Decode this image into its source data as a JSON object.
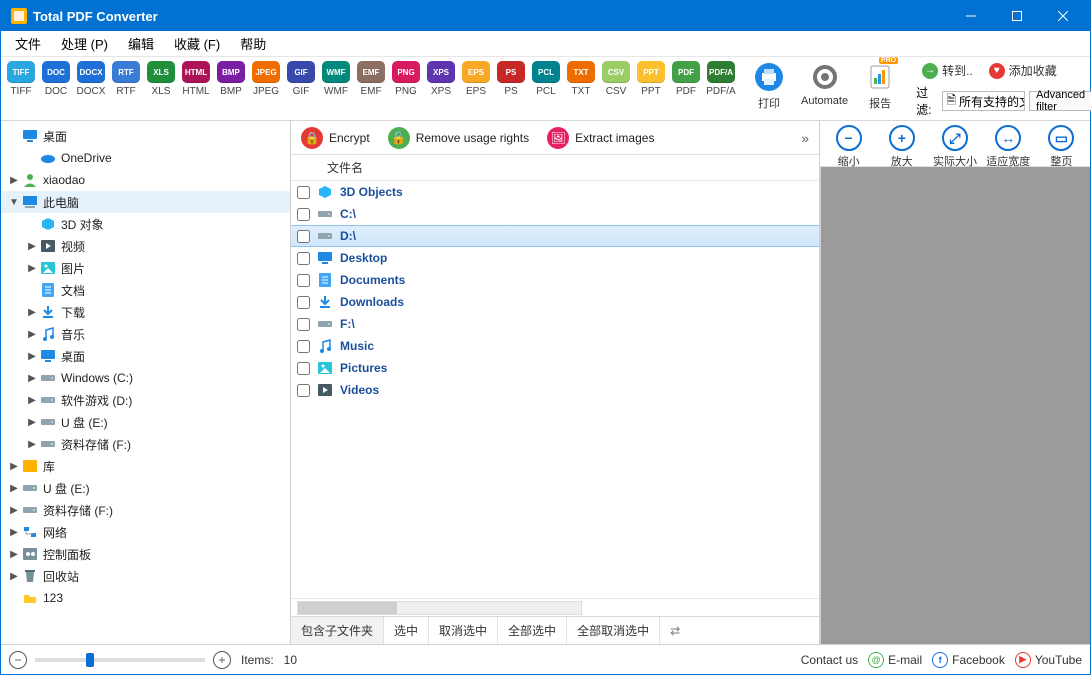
{
  "title": "Total PDF Converter",
  "menu": [
    "文件",
    "处理 (P)",
    "编辑",
    "收藏 (F)",
    "帮助"
  ],
  "formats": [
    {
      "id": "TIFF",
      "c": "#2aa7e0"
    },
    {
      "id": "DOC",
      "c": "#1e6fd6"
    },
    {
      "id": "DOCX",
      "c": "#1e6fd6"
    },
    {
      "id": "RTF",
      "c": "#3a7bd5"
    },
    {
      "id": "XLS",
      "c": "#1f8f3b"
    },
    {
      "id": "HTML",
      "c": "#ad1457"
    },
    {
      "id": "BMP",
      "c": "#7b1fa2"
    },
    {
      "id": "JPEG",
      "c": "#ef6c00"
    },
    {
      "id": "GIF",
      "c": "#3949ab"
    },
    {
      "id": "WMF",
      "c": "#00897b"
    },
    {
      "id": "EMF",
      "c": "#8d6e63"
    },
    {
      "id": "PNG",
      "c": "#d81b60"
    },
    {
      "id": "XPS",
      "c": "#5e35b1"
    },
    {
      "id": "EPS",
      "c": "#f9a825"
    },
    {
      "id": "PS",
      "c": "#c62828"
    },
    {
      "id": "PCL",
      "c": "#00838f"
    },
    {
      "id": "TXT",
      "c": "#ef6c00"
    },
    {
      "id": "CSV",
      "c": "#9ccc65"
    },
    {
      "id": "PPT",
      "c": "#fbc02d"
    },
    {
      "id": "PDF",
      "c": "#43a047"
    },
    {
      "id": "PDF/A",
      "c": "#2e7d32"
    }
  ],
  "print": "打印",
  "automate": "Automate",
  "report": "报告",
  "goto": "转到..",
  "addFav": "添加收藏",
  "filterLbl": "过滤:",
  "filterVal": "所有支持的文",
  "advFilter": "Advanced filter",
  "actions": {
    "encrypt": "Encrypt",
    "remove": "Remove usage rights",
    "extract": "Extract images"
  },
  "colHeader": "文件名",
  "tree": [
    {
      "d": 0,
      "tw": "",
      "ic": "monitor",
      "t": "桌面",
      "sel": false,
      "bold": true
    },
    {
      "d": 1,
      "tw": "",
      "ic": "cloud",
      "t": "OneDrive"
    },
    {
      "d": 0,
      "tw": "▶",
      "ic": "user",
      "t": "xiaodao"
    },
    {
      "d": 0,
      "tw": "▼",
      "ic": "pc",
      "t": "此电脑",
      "sel": true
    },
    {
      "d": 1,
      "tw": "",
      "ic": "cube",
      "t": "3D 对象"
    },
    {
      "d": 1,
      "tw": "▶",
      "ic": "video",
      "t": "视频"
    },
    {
      "d": 1,
      "tw": "▶",
      "ic": "pics",
      "t": "图片"
    },
    {
      "d": 1,
      "tw": "",
      "ic": "docs",
      "t": "文档"
    },
    {
      "d": 1,
      "tw": "▶",
      "ic": "down",
      "t": "下载"
    },
    {
      "d": 1,
      "tw": "▶",
      "ic": "music",
      "t": "音乐"
    },
    {
      "d": 1,
      "tw": "▶",
      "ic": "monitor",
      "t": "桌面"
    },
    {
      "d": 1,
      "tw": "▶",
      "ic": "drive",
      "t": "Windows (C:)"
    },
    {
      "d": 1,
      "tw": "▶",
      "ic": "drive",
      "t": "软件游戏 (D:)"
    },
    {
      "d": 1,
      "tw": "▶",
      "ic": "drive",
      "t": "U 盘 (E:)"
    },
    {
      "d": 1,
      "tw": "▶",
      "ic": "drive",
      "t": "资料存储 (F:)"
    },
    {
      "d": 0,
      "tw": "▶",
      "ic": "lib",
      "t": "库"
    },
    {
      "d": 0,
      "tw": "▶",
      "ic": "drive",
      "t": "U 盘 (E:)"
    },
    {
      "d": 0,
      "tw": "▶",
      "ic": "drive",
      "t": "资料存储 (F:)"
    },
    {
      "d": 0,
      "tw": "▶",
      "ic": "net",
      "t": "网络"
    },
    {
      "d": 0,
      "tw": "▶",
      "ic": "panel",
      "t": "控制面板"
    },
    {
      "d": 0,
      "tw": "▶",
      "ic": "bin",
      "t": "回收站"
    },
    {
      "d": 0,
      "tw": "",
      "ic": "folder",
      "t": "123"
    }
  ],
  "files": [
    {
      "ic": "cube",
      "t": "3D Objects"
    },
    {
      "ic": "drive",
      "t": "C:\\"
    },
    {
      "ic": "drive",
      "t": "D:\\",
      "sel": true
    },
    {
      "ic": "monitor",
      "t": "Desktop"
    },
    {
      "ic": "docs",
      "t": "Documents"
    },
    {
      "ic": "down",
      "t": "Downloads"
    },
    {
      "ic": "drive",
      "t": "F:\\"
    },
    {
      "ic": "music",
      "t": "Music"
    },
    {
      "ic": "pics",
      "t": "Pictures"
    },
    {
      "ic": "video",
      "t": "Videos"
    }
  ],
  "selbar": [
    "包含子文件夹",
    "选中",
    "取消选中",
    "全部选中",
    "全部取消选中"
  ],
  "pvtools": [
    {
      "g": "−",
      "t": "缩小"
    },
    {
      "g": "+",
      "t": "放大"
    },
    {
      "g": "⤢",
      "t": "实际大小"
    },
    {
      "g": "↔",
      "t": "适应宽度"
    },
    {
      "g": "▭",
      "t": "整页"
    }
  ],
  "status": {
    "itemsLbl": "Items:",
    "itemsVal": "10",
    "contact": "Contact us",
    "email": "E-mail",
    "fb": "Facebook",
    "yt": "YouTube"
  }
}
